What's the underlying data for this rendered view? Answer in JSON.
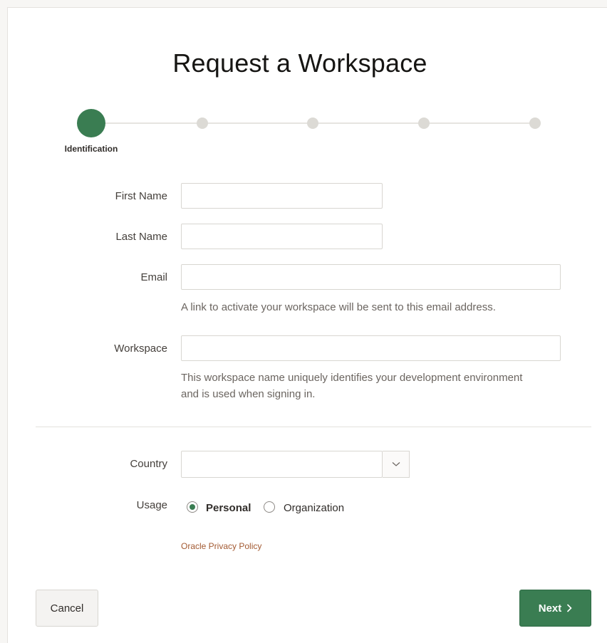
{
  "page": {
    "title": "Request a Workspace"
  },
  "tracker": {
    "steps": [
      {
        "label": "Identification",
        "active": true
      },
      {
        "label": "",
        "active": false
      },
      {
        "label": "",
        "active": false
      },
      {
        "label": "",
        "active": false
      },
      {
        "label": "",
        "active": false
      }
    ]
  },
  "form": {
    "first_name": {
      "label": "First Name",
      "value": ""
    },
    "last_name": {
      "label": "Last Name",
      "value": ""
    },
    "email": {
      "label": "Email",
      "value": "",
      "help": "A link to activate your workspace will be sent to this email address."
    },
    "workspace": {
      "label": "Workspace",
      "value": "",
      "help_line1": "This workspace name uniquely identifies your development environment",
      "help_line2": "and is used when signing in."
    },
    "country": {
      "label": "Country",
      "value": ""
    },
    "usage": {
      "label": "Usage",
      "options": [
        "Personal",
        "Organization"
      ],
      "selected": "Personal"
    },
    "privacy_link": "Oracle Privacy Policy"
  },
  "buttons": {
    "cancel": "Cancel",
    "next": "Next"
  },
  "colors": {
    "accent": "#3a7d52",
    "link": "#a35a32"
  }
}
